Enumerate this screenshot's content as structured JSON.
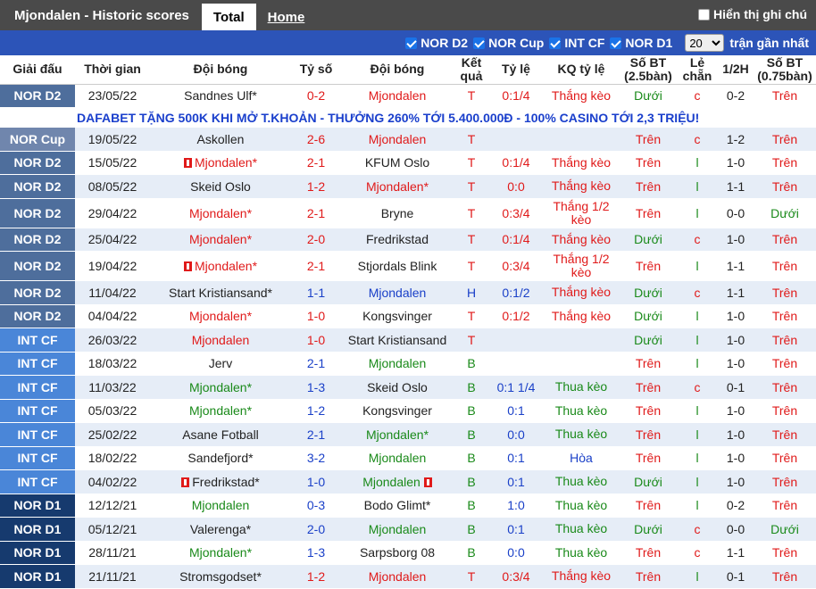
{
  "header": {
    "title": "Mjondalen - Historic scores",
    "tab_total": "Total",
    "tab_home": "Home",
    "show_chu": "Hiển thị ghi chú"
  },
  "filters": {
    "items": [
      "NOR D2",
      "NOR Cup",
      "INT CF",
      "NOR D1"
    ],
    "count": "20",
    "suffix": "trận gần nhất"
  },
  "columns": [
    "Giải đấu",
    "Thời gian",
    "Đội bóng",
    "Tỷ số",
    "Đội bóng",
    "Kết quả",
    "Tỷ lệ",
    "KQ tỷ lệ",
    "Số BT (2.5bàn)",
    "Lẻ chẵn",
    "1/2H",
    "Số BT (0.75bàn)"
  ],
  "ad": "DAFABET TẶNG 500K KHI MỞ T.KHOẢN - THƯỞNG 260% TỚI 5.400.000Đ - 100% CASINO TỚI 2,3 TRIỆU!",
  "rows": [
    {
      "league": "NOR D2",
      "date": "23/05/22",
      "home": "Sandnes Ulf",
      "home_star": "*",
      "score": "0-2",
      "away": "Mjondalen",
      "away_star": "",
      "res": "T",
      "odds": "0:1/4",
      "kq": "Thắng kèo",
      "bt": "Dưới",
      "lc": "c",
      "half": "0-2",
      "bt2": "Trên"
    },
    {
      "league": "NOR Cup",
      "date": "19/05/22",
      "home": "Askollen",
      "home_star": "",
      "score": "2-6",
      "away": "Mjondalen",
      "away_star": "",
      "res": "T",
      "odds": "",
      "kq": "",
      "bt": "Trên",
      "lc": "c",
      "half": "1-2",
      "bt2": "Trên"
    },
    {
      "league": "NOR D2",
      "date": "15/05/22",
      "home": "Mjondalen",
      "home_star": "*",
      "score": "2-1",
      "away": "KFUM Oslo",
      "away_star": "",
      "res": "T",
      "odds": "0:1/4",
      "kq": "Thắng kèo",
      "bt": "Trên",
      "lc": "l",
      "half": "1-0",
      "bt2": "Trên"
    },
    {
      "league": "NOR D2",
      "date": "08/05/22",
      "home": "Skeid Oslo",
      "home_star": "",
      "score": "1-2",
      "away": "Mjondalen",
      "away_star": "*",
      "res": "T",
      "odds": "0:0",
      "kq": "Thắng kèo",
      "bt": "Trên",
      "lc": "l",
      "half": "1-1",
      "bt2": "Trên"
    },
    {
      "league": "NOR D2",
      "date": "29/04/22",
      "home": "Mjondalen",
      "home_star": "*",
      "score": "2-1",
      "away": "Bryne",
      "away_star": "",
      "res": "T",
      "odds": "0:3/4",
      "kq": "Thắng 1/2 kèo",
      "bt": "Trên",
      "lc": "l",
      "half": "0-0",
      "bt2": "Dưới"
    },
    {
      "league": "NOR D2",
      "date": "25/04/22",
      "home": "Mjondalen",
      "home_star": "*",
      "score": "2-0",
      "away": "Fredrikstad",
      "away_star": "",
      "res": "T",
      "odds": "0:1/4",
      "kq": "Thắng kèo",
      "bt": "Dưới",
      "lc": "c",
      "half": "1-0",
      "bt2": "Trên"
    },
    {
      "league": "NOR D2",
      "date": "19/04/22",
      "home": "Mjondalen",
      "home_star": "*",
      "score": "2-1",
      "away": "Stjordals Blink",
      "away_star": "",
      "res": "T",
      "odds": "0:3/4",
      "kq": "Thắng 1/2 kèo",
      "bt": "Trên",
      "lc": "l",
      "half": "1-1",
      "bt2": "Trên"
    },
    {
      "league": "NOR D2",
      "date": "11/04/22",
      "home": "Start Kristiansand",
      "home_star": "*",
      "score": "1-1",
      "away": "Mjondalen",
      "away_star": "",
      "res": "H",
      "odds": "0:1/2",
      "kq": "Thắng kèo",
      "bt": "Dưới",
      "lc": "c",
      "half": "1-1",
      "bt2": "Trên"
    },
    {
      "league": "NOR D2",
      "date": "04/04/22",
      "home": "Mjondalen",
      "home_star": "*",
      "score": "1-0",
      "away": "Kongsvinger",
      "away_star": "",
      "res": "T",
      "odds": "0:1/2",
      "kq": "Thắng kèo",
      "bt": "Dưới",
      "lc": "l",
      "half": "1-0",
      "bt2": "Trên"
    },
    {
      "league": "INT CF",
      "date": "26/03/22",
      "home": "Mjondalen",
      "home_star": "",
      "score": "1-0",
      "away": "Start Kristiansand",
      "away_star": "",
      "res": "T",
      "odds": "",
      "kq": "",
      "bt": "Dưới",
      "lc": "l",
      "half": "1-0",
      "bt2": "Trên"
    },
    {
      "league": "INT CF",
      "date": "18/03/22",
      "home": "Jerv",
      "home_star": "",
      "score": "2-1",
      "away": "Mjondalen",
      "away_star": "",
      "res": "B",
      "odds": "",
      "kq": "",
      "bt": "Trên",
      "lc": "l",
      "half": "1-0",
      "bt2": "Trên"
    },
    {
      "league": "INT CF",
      "date": "11/03/22",
      "home": "Mjondalen",
      "home_star": "*",
      "score": "1-3",
      "away": "Skeid Oslo",
      "away_star": "",
      "res": "B",
      "odds": "0:1 1/4",
      "kq": "Thua kèo",
      "bt": "Trên",
      "lc": "c",
      "half": "0-1",
      "bt2": "Trên"
    },
    {
      "league": "INT CF",
      "date": "05/03/22",
      "home": "Mjondalen",
      "home_star": "*",
      "score": "1-2",
      "away": "Kongsvinger",
      "away_star": "",
      "res": "B",
      "odds": "0:1",
      "kq": "Thua kèo",
      "bt": "Trên",
      "lc": "l",
      "half": "1-0",
      "bt2": "Trên"
    },
    {
      "league": "INT CF",
      "date": "25/02/22",
      "home": "Asane Fotball",
      "home_star": "",
      "score": "2-1",
      "away": "Mjondalen",
      "away_star": "*",
      "res": "B",
      "odds": "0:0",
      "kq": "Thua kèo",
      "bt": "Trên",
      "lc": "l",
      "half": "1-0",
      "bt2": "Trên"
    },
    {
      "league": "INT CF",
      "date": "18/02/22",
      "home": "Sandefjord",
      "home_star": "*",
      "score": "3-2",
      "away": "Mjondalen",
      "away_star": "",
      "res": "B",
      "odds": "0:1",
      "kq": "Hòa",
      "bt": "Trên",
      "lc": "l",
      "half": "1-0",
      "bt2": "Trên"
    },
    {
      "league": "INT CF",
      "date": "04/02/22",
      "home": "Fredrikstad",
      "home_star": "*",
      "score": "1-0",
      "away": "Mjondalen",
      "away_star": "",
      "res": "B",
      "odds": "0:1",
      "kq": "Thua kèo",
      "bt": "Dưới",
      "lc": "l",
      "half": "1-0",
      "bt2": "Trên"
    },
    {
      "league": "NOR D1",
      "date": "12/12/21",
      "home": "Mjondalen",
      "home_star": "",
      "score": "0-3",
      "away": "Bodo Glimt",
      "away_star": "*",
      "res": "B",
      "odds": "1:0",
      "kq": "Thua kèo",
      "bt": "Trên",
      "lc": "l",
      "half": "0-2",
      "bt2": "Trên"
    },
    {
      "league": "NOR D1",
      "date": "05/12/21",
      "home": "Valerenga",
      "home_star": "*",
      "score": "2-0",
      "away": "Mjondalen",
      "away_star": "",
      "res": "B",
      "odds": "0:1",
      "kq": "Thua kèo",
      "bt": "Dưới",
      "lc": "c",
      "half": "0-0",
      "bt2": "Dưới"
    },
    {
      "league": "NOR D1",
      "date": "28/11/21",
      "home": "Mjondalen",
      "home_star": "*",
      "score": "1-3",
      "away": "Sarpsborg 08",
      "away_star": "",
      "res": "B",
      "odds": "0:0",
      "kq": "Thua kèo",
      "bt": "Trên",
      "lc": "c",
      "half": "1-1",
      "bt2": "Trên"
    },
    {
      "league": "NOR D1",
      "date": "21/11/21",
      "home": "Stromsgodset",
      "home_star": "*",
      "score": "1-2",
      "away": "Mjondalen",
      "away_star": "",
      "res": "T",
      "odds": "0:3/4",
      "kq": "Thắng kèo",
      "bt": "Trên",
      "lc": "l",
      "half": "0-1",
      "bt2": "Trên"
    }
  ]
}
